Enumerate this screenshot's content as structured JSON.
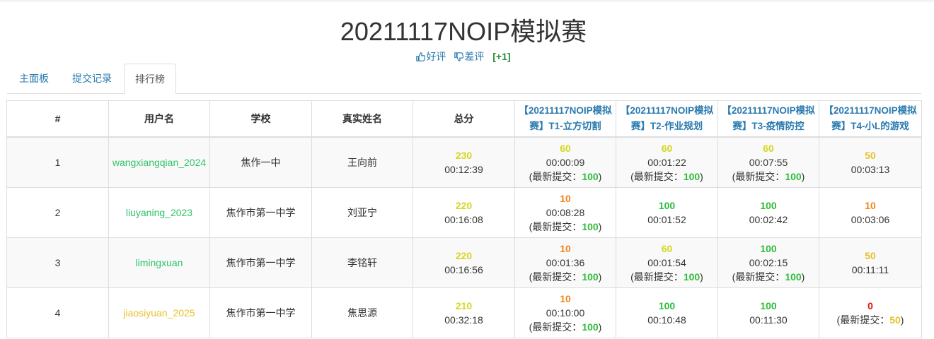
{
  "title": "20211117NOIP模拟赛",
  "votes": {
    "good": "好评",
    "bad": "差评",
    "score": "[+1]"
  },
  "tabs": [
    "主面板",
    "提交记录",
    "排行榜"
  ],
  "colors": {
    "link": "#2a7ab0",
    "yellow": "#d6d61e",
    "orange": "#f0861b",
    "green": "#2ebd3a",
    "red": "#e0140b"
  },
  "headers": {
    "rank": "#",
    "username": "用户名",
    "school": "学校",
    "realname": "真实姓名",
    "total": "总分",
    "problems": [
      "【20211117NOIP模拟赛】T1-立方切割",
      "【20211117NOIP模拟赛】T2-作业规划",
      "【20211117NOIP模拟赛】T3-疫情防控",
      "【20211117NOIP模拟赛】T4-小L的游戏"
    ]
  },
  "rows": [
    {
      "rank": "1",
      "username": "wangxiangqian_2024",
      "user_color": "teal",
      "school": "焦作一中",
      "realname": "王向前",
      "total": {
        "score": "230",
        "time": "00:12:39",
        "color": "yellow"
      },
      "problems": [
        {
          "score": "60",
          "score_color": "yellow",
          "time": "00:00:09",
          "latest_label": "(最新提交：",
          "latest": "100",
          "latest_color": "green",
          "latest_close": ")"
        },
        {
          "score": "60",
          "score_color": "yellow",
          "time": "00:01:22",
          "latest_label": "(最新提交：",
          "latest": "100",
          "latest_color": "green",
          "latest_close": ")"
        },
        {
          "score": "60",
          "score_color": "yellow",
          "time": "00:07:55",
          "latest_label": "(最新提交：",
          "latest": "100",
          "latest_color": "green",
          "latest_close": ")"
        },
        {
          "score": "50",
          "score_color": "gold",
          "time": "00:03:13"
        }
      ]
    },
    {
      "rank": "2",
      "username": "liuyaning_2023",
      "user_color": "teal",
      "school": "焦作市第一中学",
      "realname": "刘亚宁",
      "total": {
        "score": "220",
        "time": "00:16:08",
        "color": "yellow"
      },
      "problems": [
        {
          "score": "10",
          "score_color": "orange",
          "time": "00:08:28",
          "latest_label": "(最新提交：",
          "latest": "100",
          "latest_color": "green",
          "latest_close": ")"
        },
        {
          "score": "100",
          "score_color": "green",
          "time": "00:01:52"
        },
        {
          "score": "100",
          "score_color": "green",
          "time": "00:02:42"
        },
        {
          "score": "10",
          "score_color": "orange",
          "time": "00:03:06"
        }
      ]
    },
    {
      "rank": "3",
      "username": "limingxuan",
      "user_color": "teal",
      "school": "焦作市第一中学",
      "realname": "李铭轩",
      "total": {
        "score": "220",
        "time": "00:16:56",
        "color": "yellow"
      },
      "problems": [
        {
          "score": "10",
          "score_color": "orange",
          "time": "00:01:36",
          "latest_label": "(最新提交：",
          "latest": "100",
          "latest_color": "green",
          "latest_close": ")"
        },
        {
          "score": "60",
          "score_color": "yellow",
          "time": "00:01:54",
          "latest_label": "(最新提交：",
          "latest": "100",
          "latest_color": "green",
          "latest_close": ")"
        },
        {
          "score": "100",
          "score_color": "green",
          "time": "00:02:15",
          "latest_label": "(最新提交：",
          "latest": "100",
          "latest_color": "green",
          "latest_close": ")"
        },
        {
          "score": "50",
          "score_color": "gold",
          "time": "00:11:11"
        }
      ]
    },
    {
      "rank": "4",
      "username": "jiaosiyuan_2025",
      "user_color": "gold",
      "school": "焦作市第一中学",
      "realname": "焦思源",
      "total": {
        "score": "210",
        "time": "00:32:18",
        "color": "yellow"
      },
      "problems": [
        {
          "score": "10",
          "score_color": "orange",
          "time": "00:10:00",
          "latest_label": "(最新提交：",
          "latest": "100",
          "latest_color": "green",
          "latest_close": ")"
        },
        {
          "score": "100",
          "score_color": "green",
          "time": "00:10:48"
        },
        {
          "score": "100",
          "score_color": "green",
          "time": "00:11:30"
        },
        {
          "score": "0",
          "score_color": "red",
          "latest_label": "(最新提交：",
          "latest": "50",
          "latest_color": "gold",
          "latest_close": ")"
        }
      ]
    }
  ]
}
